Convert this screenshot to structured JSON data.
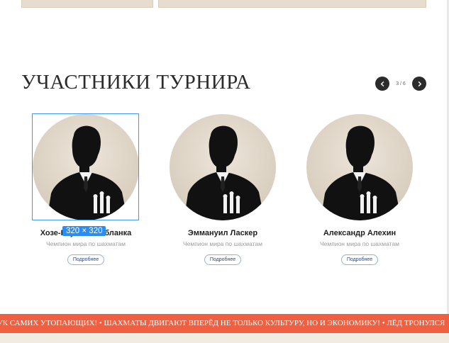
{
  "section": {
    "title": "УЧАСТНИКИ ТУРНИРА"
  },
  "pager": {
    "counter": "3 / 6",
    "prev_icon": "chevron-left-icon",
    "next_icon": "chevron-right-icon"
  },
  "members": [
    {
      "name": "Хозе-Рауль Капабланка",
      "role": "Чемпион мира по шахматам",
      "more": "Подробнее"
    },
    {
      "name": "Эммануил Ласкер",
      "role": "Чемпион мира по шахматам",
      "more": "Подробнее"
    },
    {
      "name": "Александр Алехин",
      "role": "Чемпион мира по шахматам",
      "more": "Подробнее"
    }
  ],
  "selection": {
    "dimensions": "320 × 320"
  },
  "ticker": {
    "text": "УК САМИХ УТОПАЮЩИХ! • ШАХМАТЫ ДВИГАЮТ ВПЕРЁД НЕ ТОЛЬКО КУЛЬТУРУ, НО И ЭКОНОМИКУ! • ЛЁД ТРОНУЛСЯ"
  },
  "colors": {
    "accent": "#f06040",
    "selection": "#2d8cf0",
    "dark": "#2b2b2b"
  }
}
